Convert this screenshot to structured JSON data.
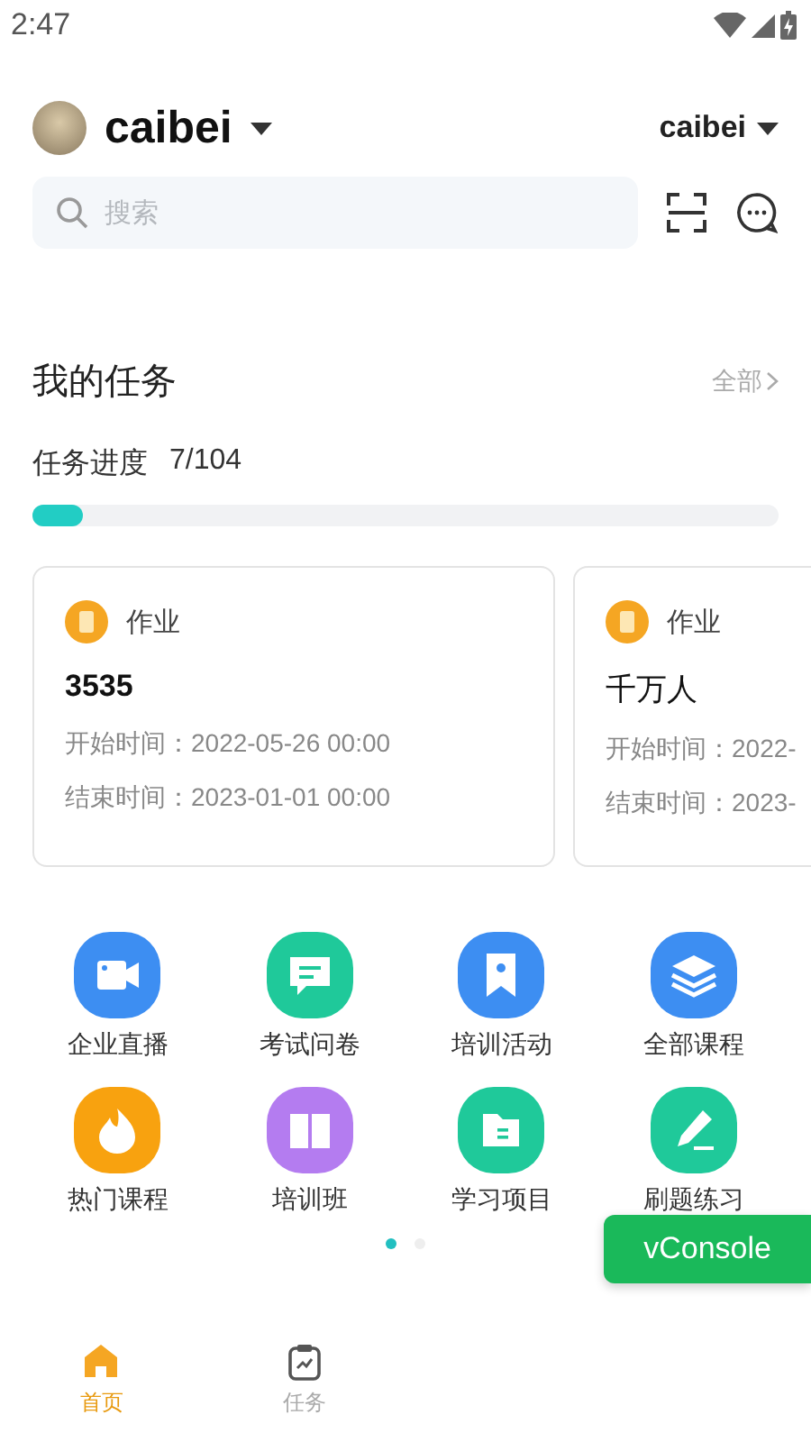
{
  "status_bar": {
    "time": "2:47"
  },
  "header": {
    "user": "caibei",
    "org": "caibei"
  },
  "search": {
    "placeholder": "搜索"
  },
  "tasks": {
    "title": "我的任务",
    "more": "全部",
    "progress_label": "任务进度",
    "progress_value": "7/104",
    "level": 0.067,
    "cards": [
      {
        "type": "作业",
        "name": "3535",
        "bold": true,
        "start": "开始时间：2022-05-26 00:00",
        "end": "结束时间：2023-01-01 00:00"
      },
      {
        "type": "作业",
        "name": "千万人",
        "bold": false,
        "start": "开始时间：2022-",
        "end": "结束时间：2023-"
      }
    ]
  },
  "shortcuts": [
    {
      "label": "企业直播",
      "kind": "camera",
      "color": "#3d8ef2"
    },
    {
      "label": "考试问卷",
      "kind": "chat",
      "color": "#1fc99a"
    },
    {
      "label": "培训活动",
      "kind": "bookmark",
      "color": "#3d8ef2"
    },
    {
      "label": "全部课程",
      "kind": "layers",
      "color": "#3d8ef2"
    },
    {
      "label": "热门课程",
      "kind": "flame",
      "color": "#f8a20f"
    },
    {
      "label": "培训班",
      "kind": "book",
      "color": "#b47cf0"
    },
    {
      "label": "学习项目",
      "kind": "folder",
      "color": "#1fc99a"
    },
    {
      "label": "刷题练习",
      "kind": "pen",
      "color": "#1fc99a"
    }
  ],
  "pager": [
    {
      "selected": true
    },
    {
      "selected": false
    }
  ],
  "vconsole": "vConsole",
  "tabbar": [
    {
      "label": "首页",
      "kind": "home",
      "selected": true
    },
    {
      "label": "任务",
      "kind": "clipboard",
      "selected": false
    }
  ]
}
